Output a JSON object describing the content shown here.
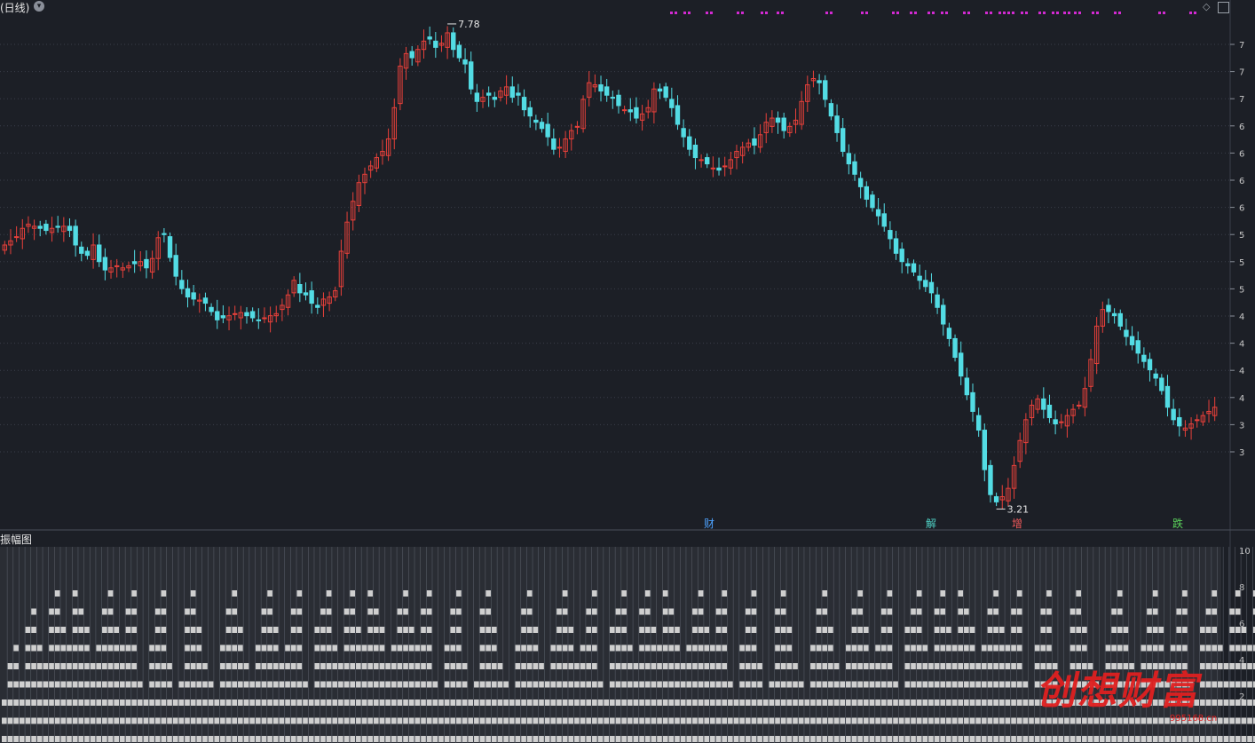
{
  "header": {
    "period_label": "(日线)"
  },
  "sub_panel": {
    "title": "振幅图"
  },
  "watermark": {
    "text": "创想财富",
    "url": "995168.cn"
  },
  "colors": {
    "background": "#1c1f26",
    "up": "#e8403a",
    "down": "#53dce4",
    "grid": "#3a3f4a",
    "marker": "#d22ad2",
    "bar": "#cfcfcf"
  },
  "chart_data": {
    "type": "candlestick",
    "y_axis_labels": [
      "7",
      "7",
      "7",
      "6",
      "6",
      "6",
      "6",
      "5",
      "5",
      "5",
      "4",
      "4",
      "4",
      "4",
      "3",
      "3"
    ],
    "annotations": [
      {
        "label": "7.78",
        "kind": "high"
      },
      {
        "label": "3.21",
        "kind": "low"
      }
    ],
    "event_markers": [
      {
        "label": "财",
        "color": "#4da3ff"
      },
      {
        "label": "解",
        "color": "#4fd1c5"
      },
      {
        "label": "增",
        "color": "#f05a5a"
      },
      {
        "label": "跌",
        "color": "#5bd35b"
      }
    ],
    "sub_axis_labels": [
      "10",
      "8",
      "6",
      "4",
      "2"
    ],
    "closes": [
      5.68,
      5.72,
      5.76,
      5.84,
      5.88,
      5.86,
      5.84,
      5.82,
      5.84,
      5.85,
      5.86,
      5.82,
      5.68,
      5.6,
      5.58,
      5.68,
      5.52,
      5.44,
      5.46,
      5.48,
      5.46,
      5.48,
      5.5,
      5.52,
      5.46,
      5.55,
      5.75,
      5.78,
      5.56,
      5.38,
      5.26,
      5.18,
      5.16,
      5.15,
      5.12,
      5.04,
      4.96,
      4.98,
      5.0,
      5.02,
      5.03,
      5.0,
      4.98,
      4.96,
      4.98,
      5.0,
      5.02,
      5.1,
      5.2,
      5.34,
      5.22,
      5.2,
      5.12,
      5.08,
      5.16,
      5.18,
      5.24,
      5.62,
      5.9,
      6.1,
      6.28,
      6.36,
      6.44,
      6.52,
      6.58,
      6.7,
      7.0,
      7.4,
      7.52,
      7.48,
      7.56,
      7.64,
      7.66,
      7.58,
      7.62,
      7.72,
      7.56,
      7.48,
      7.42,
      7.18,
      7.06,
      7.1,
      7.12,
      7.08,
      7.16,
      7.2,
      7.1,
      7.12,
      6.98,
      6.92,
      6.86,
      6.8,
      6.72,
      6.6,
      6.62,
      6.7,
      6.78,
      6.82,
      7.08,
      7.24,
      7.22,
      7.16,
      7.12,
      7.1,
      7.02,
      6.98,
      6.96,
      6.9,
      6.94,
      7.0,
      7.18,
      7.16,
      7.1,
      7.0,
      6.84,
      6.72,
      6.6,
      6.52,
      6.5,
      6.46,
      6.42,
      6.4,
      6.44,
      6.5,
      6.58,
      6.62,
      6.66,
      6.64,
      6.74,
      6.86,
      6.9,
      6.86,
      6.78,
      6.82,
      6.88,
      7.06,
      7.22,
      7.28,
      7.24,
      7.08,
      6.92,
      6.76,
      6.58,
      6.46,
      6.36,
      6.24,
      6.12,
      6.04,
      5.96,
      5.86,
      5.74,
      5.6,
      5.52,
      5.48,
      5.42,
      5.34,
      5.28,
      5.22,
      5.08,
      4.92,
      4.78,
      4.6,
      4.42,
      4.24,
      4.08,
      3.9,
      3.52,
      3.28,
      3.21,
      3.26,
      3.34,
      3.56,
      3.8,
      4.0,
      4.14,
      4.2,
      4.1,
      4.02,
      3.96,
      3.98,
      4.04,
      4.1,
      4.14,
      4.3,
      4.58,
      4.9,
      5.06,
      5.04,
      5.0,
      4.9,
      4.8,
      4.72,
      4.64,
      4.56,
      4.48,
      4.4,
      4.28,
      4.12,
      4.0,
      3.94,
      3.92,
      3.96,
      4.0,
      4.04,
      4.08,
      4.12
    ],
    "amplitude": [
      3,
      5,
      6,
      4,
      7,
      8,
      6,
      5,
      8,
      9,
      7,
      6,
      9,
      8,
      7,
      5,
      6,
      8,
      9,
      7,
      6,
      8,
      9,
      4,
      3,
      6,
      8,
      9,
      5,
      3,
      4,
      8,
      9,
      7,
      5,
      4,
      3,
      6,
      8,
      9,
      7,
      5,
      4,
      6,
      8,
      9,
      7,
      5,
      6,
      8,
      9,
      4,
      3,
      7,
      8,
      9,
      6,
      5,
      8,
      9,
      7,
      6,
      9,
      8,
      7,
      5,
      6,
      8,
      9,
      7,
      6,
      8,
      9,
      4,
      3,
      6,
      8,
      9,
      5,
      3,
      4,
      8,
      9,
      7,
      5,
      4,
      3,
      6,
      8,
      9,
      7,
      5,
      4,
      6,
      8,
      9,
      7,
      5,
      6,
      8,
      9,
      4,
      3,
      7,
      8,
      9,
      6,
      5,
      8,
      9,
      7,
      6,
      9,
      8,
      7,
      5,
      6,
      8,
      9,
      7,
      6,
      8,
      9,
      4,
      3,
      6,
      8,
      9,
      5,
      3,
      4,
      8,
      9,
      7,
      5,
      4,
      3,
      6,
      8,
      9,
      7,
      5,
      4,
      6,
      8,
      9,
      7,
      5,
      6,
      8,
      9,
      4,
      3,
      7,
      8,
      9,
      6,
      5,
      8,
      9,
      7,
      6,
      9,
      8,
      7,
      5,
      6,
      8,
      9,
      7,
      6,
      8,
      9,
      4,
      3,
      6,
      8,
      9,
      5,
      3,
      4,
      8,
      9,
      7,
      5,
      4,
      3,
      6,
      8,
      9,
      7,
      5,
      4,
      6,
      8,
      9,
      7,
      5,
      6,
      8,
      9,
      4,
      3,
      7,
      8,
      9,
      6,
      5,
      8,
      9,
      7,
      6,
      9,
      8,
      7,
      5,
      6,
      8,
      9,
      7
    ]
  }
}
